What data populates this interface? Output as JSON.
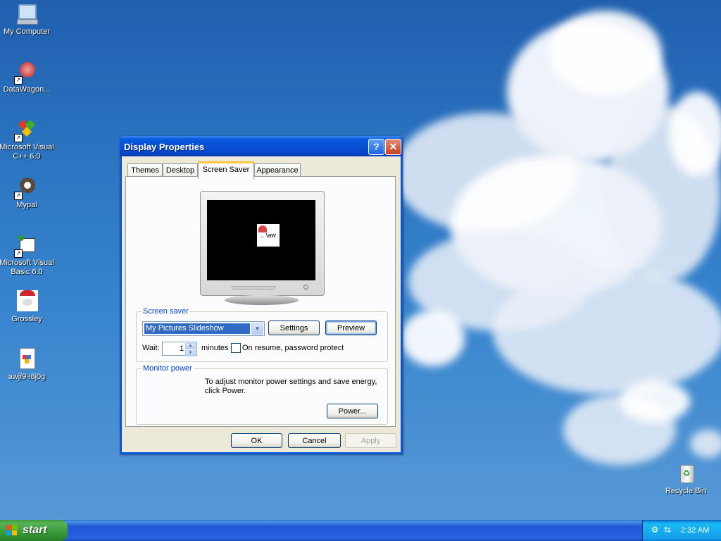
{
  "desktop": {
    "icons": [
      {
        "label": "My Computer",
        "icon": "my-computer-icon"
      },
      {
        "label": "DataWagon...",
        "icon": "datawagon-shortcut-icon"
      },
      {
        "label": "Microsoft Visual C++ 6.0",
        "icon": "visual-cpp-icon"
      },
      {
        "label": "Mypal",
        "icon": "mypal-shortcut-icon"
      },
      {
        "label": "Microsoft Visual Basic 6.0",
        "icon": "visual-basic-icon"
      },
      {
        "label": "Grossley",
        "icon": "grossley-icon"
      },
      {
        "label": "awjf9-i8j0g",
        "icon": "image-file-icon"
      },
      {
        "label": "Recycle Bin",
        "icon": "recycle-bin-icon"
      }
    ]
  },
  "dialog": {
    "title": "Display Properties",
    "help_glyph": "?",
    "close_glyph": "✕",
    "tabs": [
      {
        "label": "Themes",
        "active": false
      },
      {
        "label": "Desktop",
        "active": false
      },
      {
        "label": "Screen Saver",
        "active": true
      },
      {
        "label": "Appearance",
        "active": false
      }
    ],
    "preview_text": "...\\aw",
    "screen_saver": {
      "group_label": "Screen saver",
      "selected": "My Pictures Slideshow",
      "settings_label": "Settings",
      "preview_label": "Preview",
      "wait_label": "Wait:",
      "wait_value": "1",
      "minutes_label": "minutes",
      "password_label": "On resume, password protect",
      "password_checked": false
    },
    "monitor_power": {
      "group_label": "Monitor power",
      "description": "To adjust monitor power settings and save energy, click Power.",
      "power_label": "Power..."
    },
    "ok_label": "OK",
    "cancel_label": "Cancel",
    "apply_label": "Apply"
  },
  "taskbar": {
    "start_label": "start",
    "clock": "2:32 AM"
  },
  "colors": {
    "xp_blue": "#0a55d8",
    "start_green": "#379b37",
    "dialog_bg": "#ece9d8",
    "group_label": "#0046d5"
  }
}
